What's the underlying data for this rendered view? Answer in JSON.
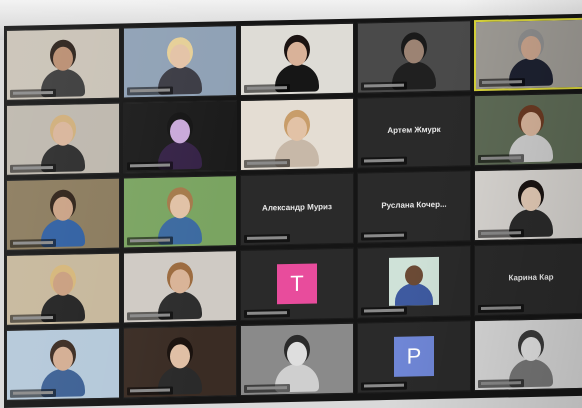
{
  "colors": {
    "active_speaker_border": "#d6d23a",
    "avatar_pink": "#e84c9c",
    "avatar_blue": "#6f86d6",
    "tile_bg": "#2a2a2a"
  },
  "grid": {
    "rows": 5,
    "columns": 5,
    "tiles": [
      {
        "type": "video",
        "bg": "#c9c2b6",
        "skin": "#b98d70",
        "hair": "#2a2019",
        "shirt": "#3a3a3a"
      },
      {
        "type": "video",
        "bg": "#8fa1b5",
        "skin": "#e3c3a6",
        "hair": "#e6cf97",
        "shirt": "#3b3b44"
      },
      {
        "type": "video",
        "bg": "#dedcd6",
        "skin": "#d9b299",
        "hair": "#1c1412",
        "shirt": "#161616"
      },
      {
        "type": "video",
        "bg": "#4a4a4a",
        "skin": "#9c8373",
        "hair": "#1a1a1a",
        "shirt": "#202020"
      },
      {
        "type": "video",
        "bg": "#9d9a94",
        "skin": "#c7a28b",
        "hair": "#8d8d8d",
        "shirt": "#1d2130",
        "active": true
      },
      {
        "type": "video",
        "bg": "#bdb7ad",
        "skin": "#d8b49a",
        "hair": "#cfae7a",
        "shirt": "#2a2a2a"
      },
      {
        "type": "video",
        "bg": "#1b1b1b",
        "skin": "#c9a9d9",
        "hair": "#151515",
        "shirt": "#352246"
      },
      {
        "type": "video",
        "bg": "#e4ddd3",
        "skin": "#e2c2a6",
        "hair": "#c89d6a",
        "shirt": "#c7b8a8"
      },
      {
        "type": "name",
        "name": "Артем Жмурк"
      },
      {
        "type": "video",
        "bg": "#5e6b56",
        "skin": "#d7b49b",
        "hair": "#6b3a22",
        "shirt": "#cfcfcf"
      },
      {
        "type": "video",
        "bg": "#8a7a5c",
        "skin": "#c9a184",
        "hair": "#2d2016",
        "shirt": "#2e5ea1"
      },
      {
        "type": "video",
        "bg": "#7aa461",
        "skin": "#e1c1a6",
        "hair": "#a57a4b",
        "shirt": "#3c6aa0"
      },
      {
        "type": "name",
        "name": "Александр Муриз"
      },
      {
        "type": "name",
        "name": "Руслана Кочер..."
      },
      {
        "type": "video",
        "bg": "#d9d6d2",
        "skin": "#e6cdb8",
        "hair": "#1a1412",
        "shirt": "#2b2b2b"
      },
      {
        "type": "video",
        "bg": "#c6b79b",
        "skin": "#c99e7e",
        "hair": "#d5b679",
        "shirt": "#212121"
      },
      {
        "type": "video",
        "bg": "#cfcac4",
        "skin": "#d9b397",
        "hair": "#9c6b3f",
        "shirt": "#2d2d2d"
      },
      {
        "type": "letter",
        "letter": "T",
        "color": "#e84c9c"
      },
      {
        "type": "photo"
      },
      {
        "type": "name",
        "name": "Карина Кар"
      },
      {
        "type": "video",
        "bg": "#b4c8d9",
        "skin": "#d3ad92",
        "hair": "#3a2a20",
        "shirt": "#3b5f93"
      },
      {
        "type": "video",
        "bg": "#3a2c24",
        "skin": "#e0bfa5",
        "hair": "#1a120e",
        "shirt": "#2a2a2a"
      },
      {
        "type": "video",
        "bg": "#8a8a8a",
        "skin": "#dedede",
        "hair": "#2a2a2a",
        "shirt": "#cfcfcf"
      },
      {
        "type": "letter",
        "letter": "P",
        "color": "#6f86d6"
      },
      {
        "type": "video",
        "bg": "#d8d8d8",
        "skin": "#e4e4e4",
        "hair": "#3a3a3a",
        "shirt": "#777777"
      }
    ]
  }
}
